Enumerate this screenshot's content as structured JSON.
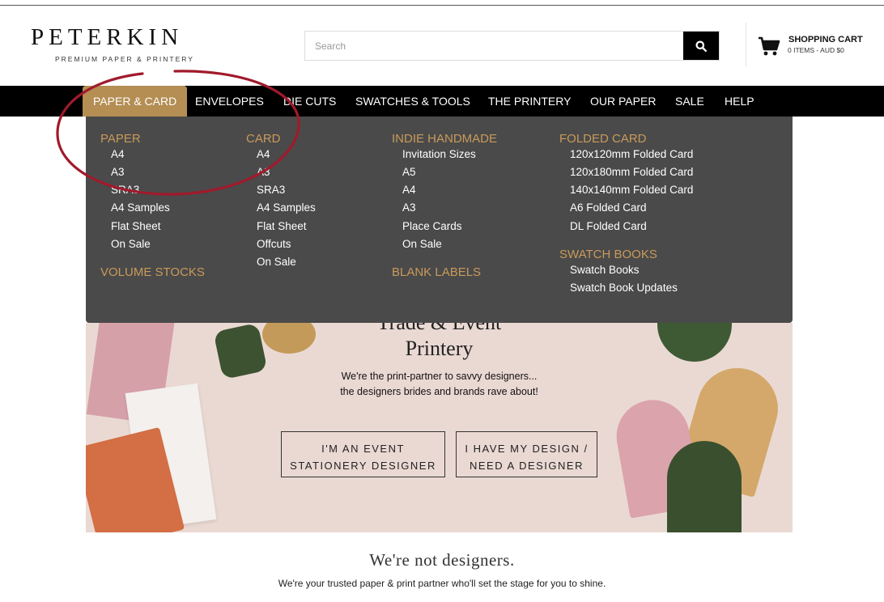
{
  "brand": {
    "name": "PETERKIN",
    "tagline": "PREMIUM PAPER & PRINTERY"
  },
  "search": {
    "placeholder": "Search",
    "icon": "search-icon"
  },
  "cart": {
    "title": "SHOPPING CART",
    "summary": "0 ITEMS - AUD $0",
    "icon": "cart-icon"
  },
  "nav": {
    "items": [
      {
        "label": "PAPER & CARD"
      },
      {
        "label": "ENVELOPES"
      },
      {
        "label": "DIE CUTS"
      },
      {
        "label": "SWATCHES & TOOLS"
      },
      {
        "label": "THE PRINTERY"
      },
      {
        "label": "OUR PAPER"
      },
      {
        "label": "SALE"
      },
      {
        "label": "HELP"
      }
    ]
  },
  "mega_menu": {
    "paper": {
      "heading": "PAPER",
      "links": [
        "A4",
        "A3",
        "SRA3",
        "A4 Samples",
        "Flat Sheet",
        "On Sale"
      ]
    },
    "volume_stocks": {
      "heading": "VOLUME STOCKS"
    },
    "card": {
      "heading": "CARD",
      "links": [
        "A4",
        "A3",
        "SRA3",
        "A4 Samples",
        "Flat Sheet",
        "Offcuts",
        "On Sale"
      ]
    },
    "indie": {
      "heading": "INDIE HANDMADE",
      "links": [
        "Invitation Sizes",
        "A5",
        "A4",
        "A3",
        "Place Cards",
        "On Sale"
      ]
    },
    "blank_labels": {
      "heading": "BLANK LABELS"
    },
    "folded": {
      "heading": "FOLDED CARD",
      "links": [
        "120x120mm Folded Card",
        "120x180mm Folded Card",
        "140x140mm Folded Card",
        "A6 Folded Card",
        "DL Folded Card"
      ]
    },
    "swatch": {
      "heading": "SWATCH BOOKS",
      "links": [
        "Swatch Books",
        "Swatch Book Updates"
      ]
    }
  },
  "hero": {
    "title_line1": "Trade & Event",
    "title_line2": "Printery",
    "sub_line1": "We're the print-partner to savvy designers...",
    "sub_line2": "the designers brides and brands rave about!",
    "btn1_line1": "I'M AN EVENT",
    "btn1_line2": "STATIONERY DESIGNER",
    "btn2_line1": "I HAVE MY DESIGN /",
    "btn2_line2": "NEED A DESIGNER"
  },
  "bottom": {
    "title": "We're not designers.",
    "sub": "We're your trusted paper & print partner who'll set the stage for you to shine."
  },
  "colors": {
    "accent": "#b48e53",
    "menu_heading": "#c99a5a",
    "menu_bg": "#4a4a4a",
    "nav_bg": "#000000",
    "annotation": "#a01a2c"
  }
}
